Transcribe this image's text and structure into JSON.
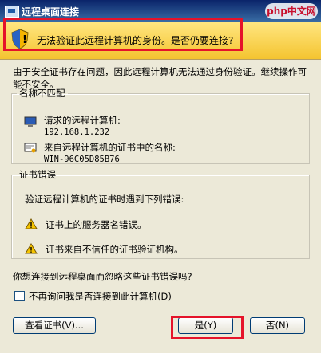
{
  "window": {
    "title": "远程桌面连接"
  },
  "banner": {
    "message": "无法验证此远程计算机的身份。是否仍要连接?"
  },
  "intro": "由于安全证书存在问题，因此远程计算机无法通过身份验证。继续操作可能不安全。",
  "name_mismatch": {
    "legend": "名称不匹配",
    "requested_label": "请求的远程计算机:",
    "requested_value": "192.168.1.232",
    "cert_label": "来自远程计算机的证书中的名称:",
    "cert_value": "WIN-96C05D85B76"
  },
  "cert_errors": {
    "legend": "证书错误",
    "intro": "验证远程计算机的证书时遇到下列错误:",
    "items": [
      "证书上的服务器名错误。",
      "证书来自不信任的证书验证机构。"
    ]
  },
  "question": "你想连接到远程桌面而忽略这些证书错误吗?",
  "checkbox": {
    "label": "不再询问我是否连接到此计算机(D)",
    "checked": false
  },
  "buttons": {
    "view_cert": "查看证书(V)...",
    "yes": "是(Y)",
    "no": "否(N)"
  },
  "watermark": "php中文网",
  "colors": {
    "highlight": "#e5132a",
    "banner": "#f4c430",
    "title_bar": "#0a246a"
  }
}
